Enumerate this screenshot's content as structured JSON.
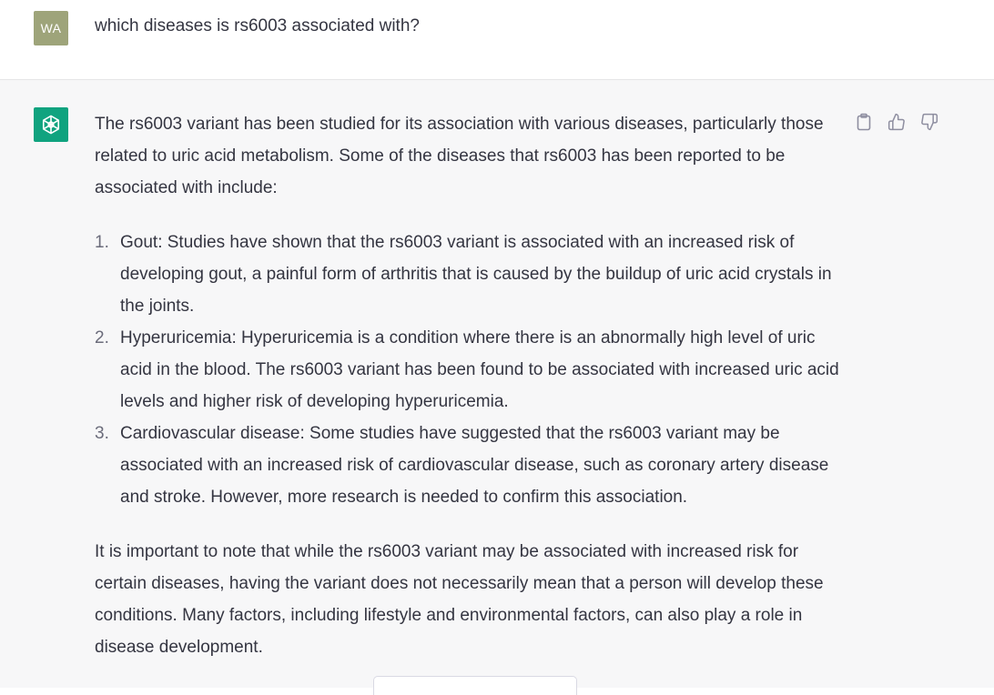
{
  "user": {
    "avatar_initials": "WA",
    "avatar_color": "#9ea47a",
    "message": "which diseases is rs6003 associated with?"
  },
  "assistant": {
    "avatar_icon": "openai-logo-icon",
    "avatar_color": "#10a37f",
    "intro": "The rs6003 variant has been studied for its association with various diseases, particularly those related to uric acid metabolism. Some of the diseases that rs6003 has been reported to be associated with include:",
    "list": [
      {
        "number": "1.",
        "text": "Gout: Studies have shown that the rs6003 variant is associated with an increased risk of developing gout, a painful form of arthritis that is caused by the buildup of uric acid crystals in the joints."
      },
      {
        "number": "2.",
        "text": "Hyperuricemia: Hyperuricemia is a condition where there is an abnormally high level of uric acid in the blood. The rs6003 variant has been found to be associated with increased uric acid levels and higher risk of developing hyperuricemia."
      },
      {
        "number": "3.",
        "text": "Cardiovascular disease: Some studies have suggested that the rs6003 variant may be associated with an increased risk of cardiovascular disease, such as coronary artery disease and stroke. However, more research is needed to confirm this association."
      }
    ],
    "conclusion": "It is important to note that while the rs6003 variant may be associated with increased risk for certain diseases, having the variant does not necessarily mean that a person will develop these conditions. Many factors, including lifestyle and environmental factors, can also play a role in disease development."
  },
  "actions": {
    "copy_icon": "clipboard-icon",
    "like_icon": "thumbs-up-icon",
    "dislike_icon": "thumbs-down-icon"
  }
}
